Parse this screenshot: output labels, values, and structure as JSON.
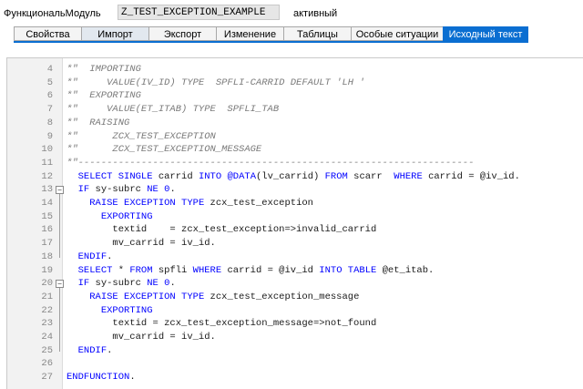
{
  "header": {
    "label": "ФункциональМодуль",
    "module_name": "Z_TEST_EXCEPTION_EXAMPLE",
    "status": "активный"
  },
  "tabs": [
    {
      "label": "Свойства"
    },
    {
      "label": "Импорт"
    },
    {
      "label": "Экспорт"
    },
    {
      "label": "Изменение"
    },
    {
      "label": "Таблицы"
    },
    {
      "label": "Особые ситуации"
    },
    {
      "label": "Исходный текст"
    }
  ],
  "active_tab": "Исходный текст",
  "code_lines": [
    {
      "num": "4",
      "text": "*\"  IMPORTING"
    },
    {
      "num": "5",
      "text": "*\"     VALUE(IV_ID) TYPE  SPFLI-CARRID DEFAULT 'LH '"
    },
    {
      "num": "6",
      "text": "*\"  EXPORTING"
    },
    {
      "num": "7",
      "text": "*\"     VALUE(ET_ITAB) TYPE  SPFLI_TAB"
    },
    {
      "num": "8",
      "text": "*\"  RAISING"
    },
    {
      "num": "9",
      "text": "*\"      ZCX_TEST_EXCEPTION"
    },
    {
      "num": "10",
      "text": "*\"      ZCX_TEST_EXCEPTION_MESSAGE"
    },
    {
      "num": "11",
      "text": "*\"---------------------------------------------------------------------"
    },
    {
      "num": "12",
      "text": "  SELECT SINGLE carrid INTO @DATA(lv_carrid) FROM scarr  WHERE carrid = @iv_id."
    },
    {
      "num": "13",
      "text": "  IF sy-subrc NE 0."
    },
    {
      "num": "14",
      "text": "    RAISE EXCEPTION TYPE zcx_test_exception"
    },
    {
      "num": "15",
      "text": "      EXPORTING"
    },
    {
      "num": "16",
      "text": "        textid    = zcx_test_exception=>invalid_carrid"
    },
    {
      "num": "17",
      "text": "        mv_carrid = iv_id."
    },
    {
      "num": "18",
      "text": "  ENDIF."
    },
    {
      "num": "19",
      "text": "  SELECT * FROM spfli WHERE carrid = @iv_id INTO TABLE @et_itab."
    },
    {
      "num": "20",
      "text": "  IF sy-subrc NE 0."
    },
    {
      "num": "21",
      "text": "    RAISE EXCEPTION TYPE zcx_test_exception_message"
    },
    {
      "num": "22",
      "text": "      EXPORTING"
    },
    {
      "num": "23",
      "text": "        textid = zcx_test_exception_message=>not_found"
    },
    {
      "num": "24",
      "text": "        mv_carrid = iv_id."
    },
    {
      "num": "25",
      "text": "  ENDIF."
    },
    {
      "num": "26",
      "text": ""
    },
    {
      "num": "27",
      "text": "ENDFUNCTION."
    }
  ],
  "colors": {
    "active_tab": "#0a6ed1",
    "keyword": "#0000ff",
    "comment": "#7a7a7a"
  }
}
